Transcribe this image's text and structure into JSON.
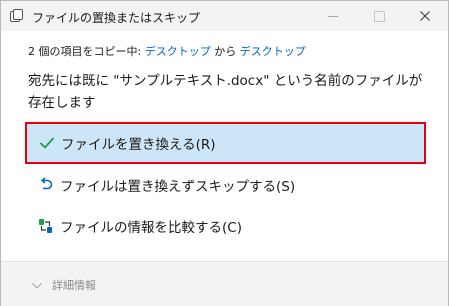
{
  "window": {
    "title": "ファイルの置換またはスキップ",
    "icon": "copy-dialog-icon"
  },
  "status": {
    "prefix": "2 個の項目をコピー中: ",
    "source": "デスクトップ",
    "middle": " から ",
    "destination": "デスクトップ"
  },
  "message": "宛先には既に \"サンプルテキスト.docx\" という名前のファイルが存在します",
  "options": [
    {
      "label": "ファイルを置き換える(R)",
      "icon": "checkmark-icon"
    },
    {
      "label": "ファイルは置き換えずスキップする(S)",
      "icon": "undo-arrow-icon"
    },
    {
      "label": "ファイルの情報を比較する(C)",
      "icon": "compare-icon"
    }
  ],
  "footer": {
    "details_label": "詳細情報"
  },
  "colors": {
    "accent": "#0067c0",
    "selected_bg": "#cde6f7",
    "highlight_border": "#e8000f",
    "check_green": "#16a34a"
  }
}
